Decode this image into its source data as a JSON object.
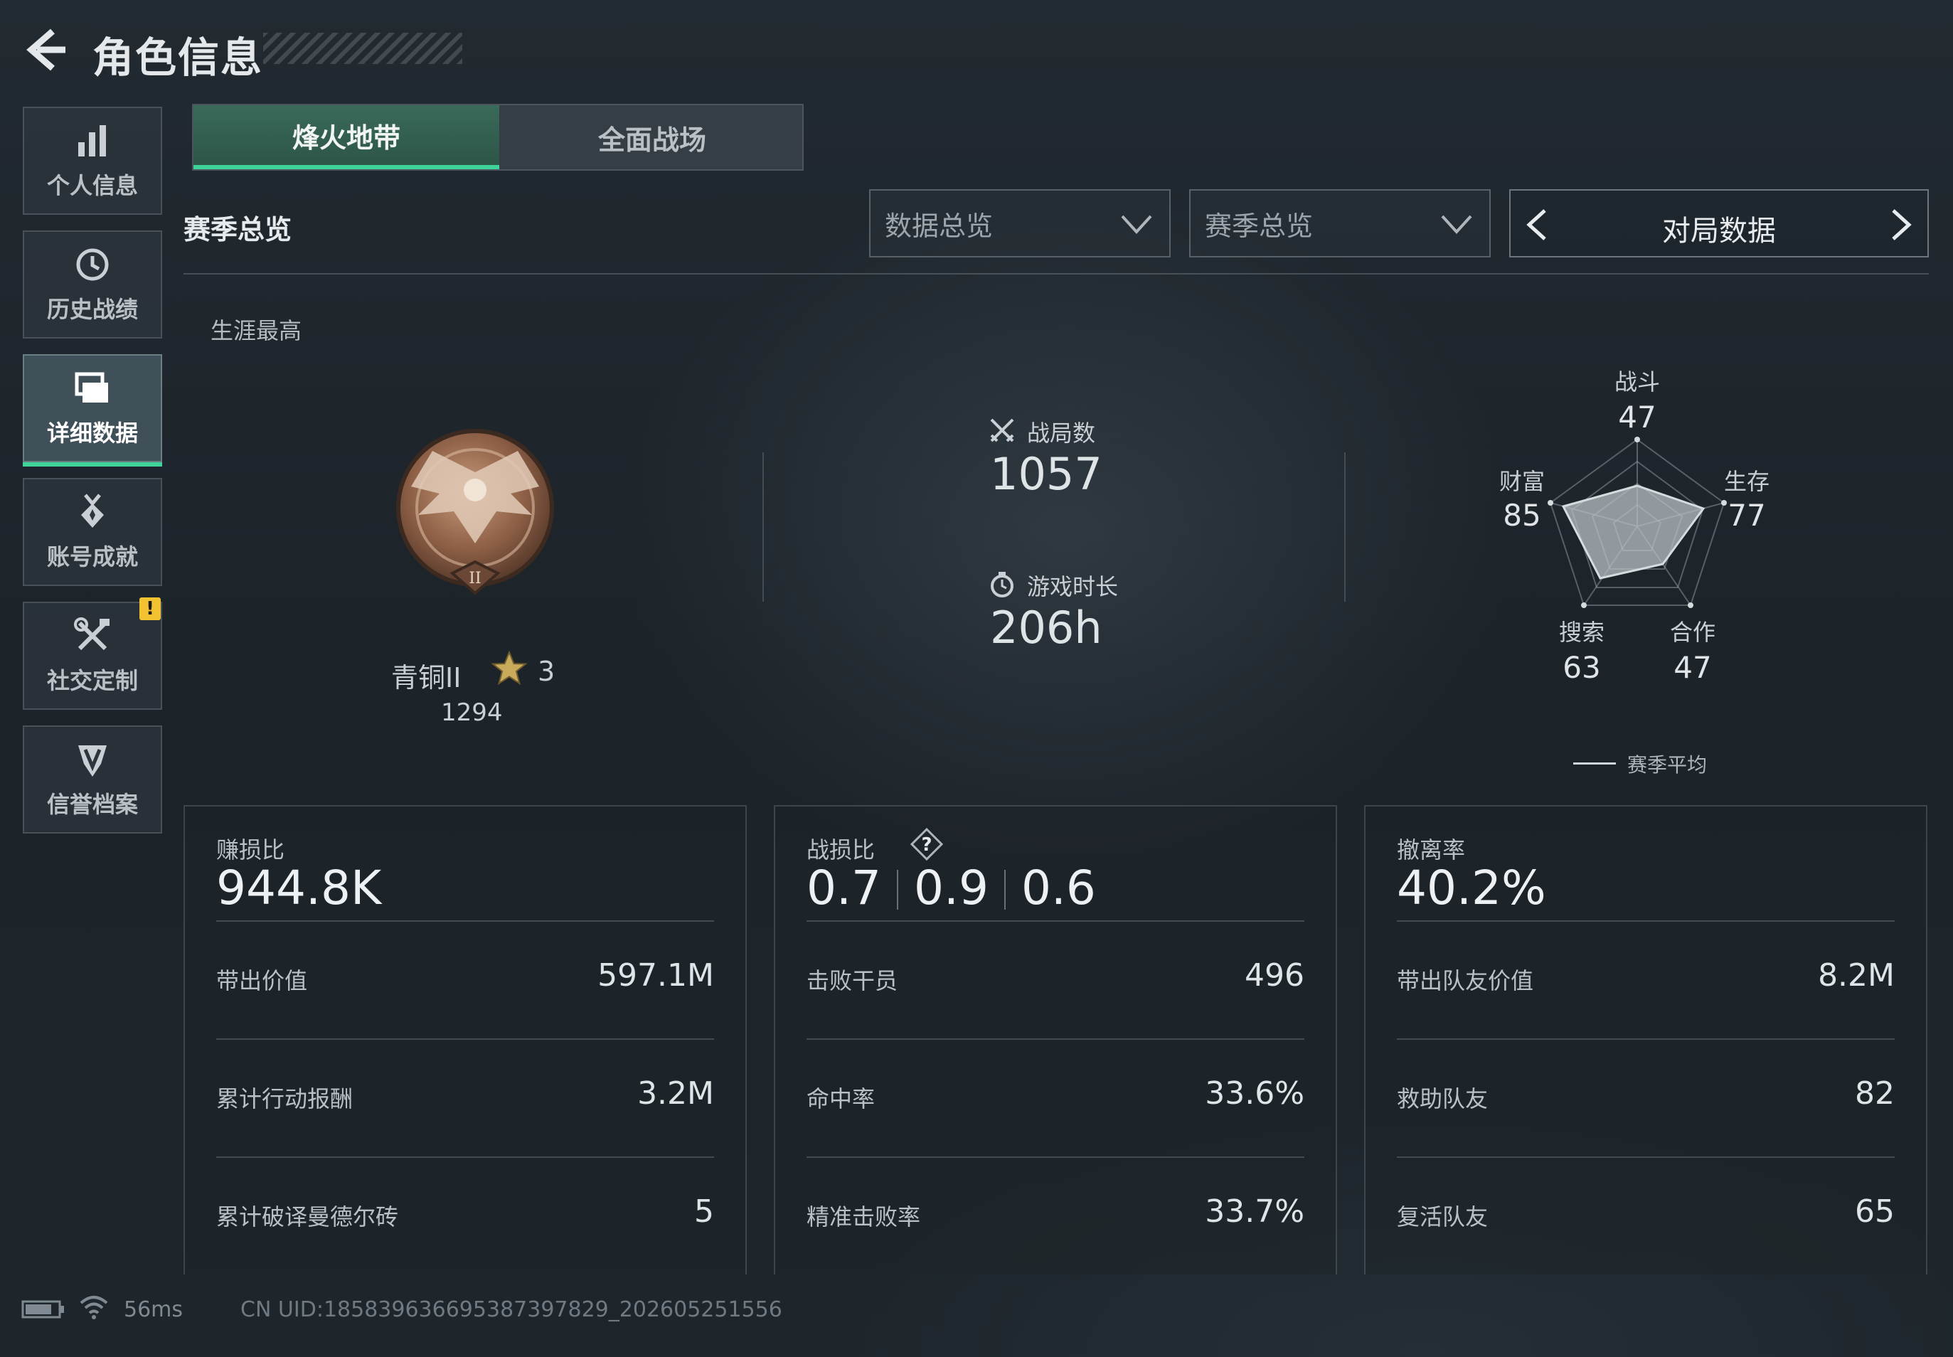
{
  "header": {
    "title": "角色信息"
  },
  "sidebar": {
    "items": [
      {
        "label": "个人信息",
        "icon": "bar-chart-icon",
        "active": false
      },
      {
        "label": "历史战绩",
        "icon": "history-clock-icon",
        "active": false
      },
      {
        "label": "详细数据",
        "icon": "cards-icon",
        "active": true
      },
      {
        "label": "账号成就",
        "icon": "achievement-medal-icon",
        "active": false
      },
      {
        "label": "社交定制",
        "icon": "tools-icon",
        "active": false,
        "badge": "!"
      },
      {
        "label": "信誉档案",
        "icon": "shield-v-icon",
        "active": false
      }
    ]
  },
  "tabs": [
    {
      "label": "烽火地带",
      "active": true
    },
    {
      "label": "全面战场",
      "active": false
    }
  ],
  "filters": {
    "section_title": "赛季总览",
    "dropdown1": "数据总览",
    "dropdown2": "赛季总览",
    "pager_label": "对局数据"
  },
  "career": {
    "label": "生涯最高",
    "rank_name": "青铜II",
    "rank_stars": "3",
    "rank_score": "1294",
    "matches_label": "战局数",
    "matches_value": "1057",
    "playtime_label": "游戏时长",
    "playtime_value": "206h"
  },
  "radar": {
    "labels": {
      "combat": "战斗",
      "survival": "生存",
      "teamwork": "合作",
      "search": "搜索",
      "wealth": "财富"
    },
    "values": {
      "combat": "47",
      "survival": "77",
      "teamwork": "47",
      "search": "63",
      "wealth": "85"
    },
    "legend": "赛季平均"
  },
  "cards": {
    "profit": {
      "label": "赚损比",
      "value": "944.8K",
      "rows": [
        {
          "label": "带出价值",
          "value": "597.1M"
        },
        {
          "label": "累计行动报酬",
          "value": "3.2M"
        },
        {
          "label": "累计破译曼德尔砖",
          "value": "5"
        }
      ]
    },
    "kd": {
      "label": "战损比",
      "help": "?",
      "values": [
        "0.7",
        "0.9",
        "0.6"
      ],
      "rows": [
        {
          "label": "击败干员",
          "value": "496"
        },
        {
          "label": "命中率",
          "value": "33.6%"
        },
        {
          "label": "精准击败率",
          "value": "33.7%"
        }
      ]
    },
    "extract": {
      "label": "撤离率",
      "value": "40.2%",
      "rows": [
        {
          "label": "带出队友价值",
          "value": "8.2M"
        },
        {
          "label": "救助队友",
          "value": "82"
        },
        {
          "label": "复活队友",
          "value": "65"
        }
      ]
    }
  },
  "footer": {
    "ping": "56ms",
    "uid": "CN UID:1858396366953873978​29_202605251556"
  },
  "colors": {
    "accent": "#3fd29a",
    "badge": "#f2c230",
    "background": "#1d242b"
  }
}
